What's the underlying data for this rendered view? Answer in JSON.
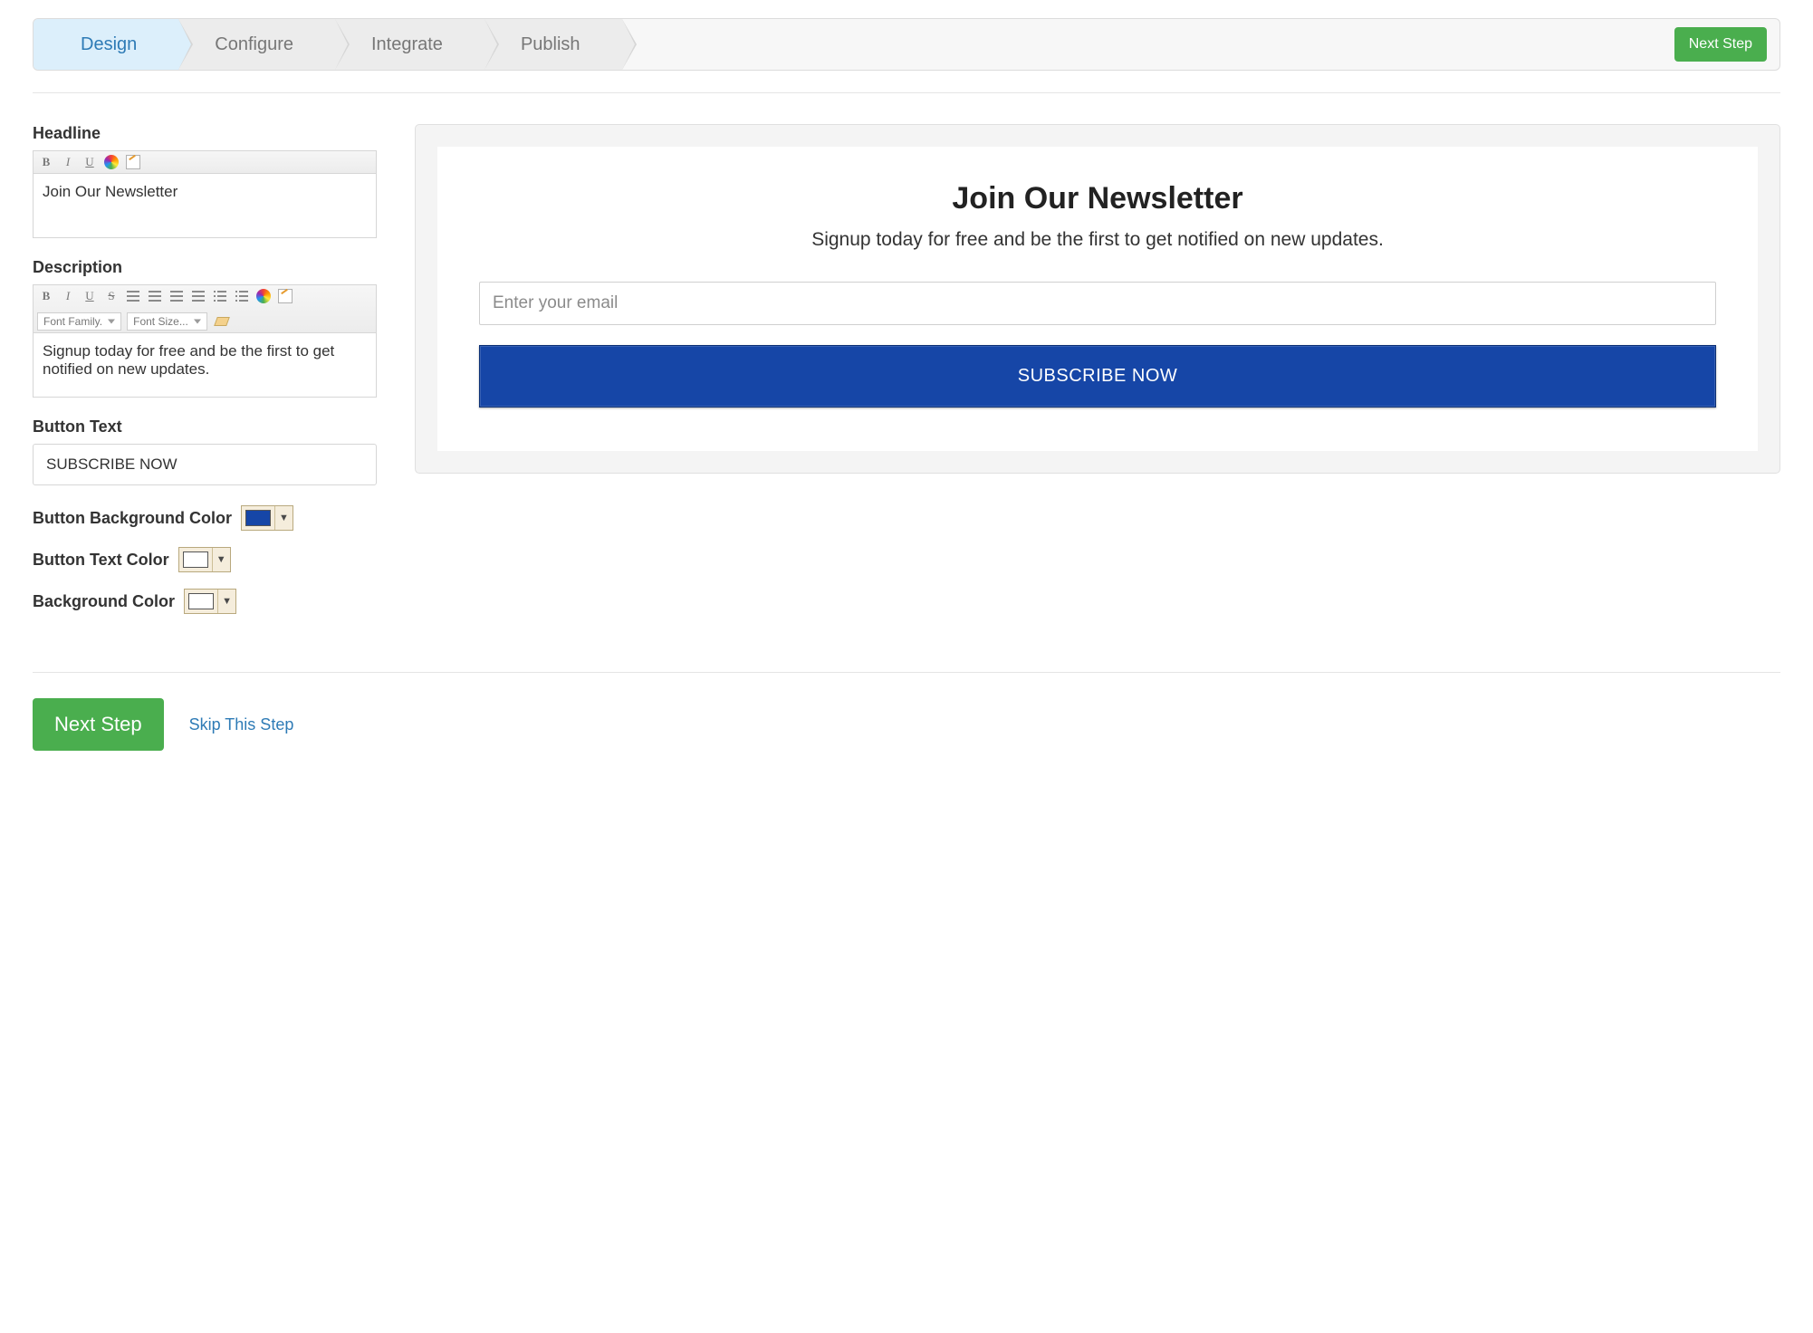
{
  "wizard": {
    "steps": [
      "Design",
      "Configure",
      "Integrate",
      "Publish"
    ],
    "active_index": 0,
    "next_button": "Next Step"
  },
  "form": {
    "headline": {
      "label": "Headline",
      "value": "Join Our Newsletter"
    },
    "description": {
      "label": "Description",
      "value": "Signup today for free and be the first to get notified on new updates.",
      "font_family_placeholder": "Font Family.",
      "font_size_placeholder": "Font Size..."
    },
    "button_text": {
      "label": "Button Text",
      "value": "SUBSCRIBE NOW"
    },
    "button_bg": {
      "label": "Button Background Color",
      "value": "#1646a7"
    },
    "button_text_color": {
      "label": "Button Text Color",
      "value": "#ffffff"
    },
    "background_color": {
      "label": "Background Color",
      "value": "#ffffff"
    }
  },
  "preview": {
    "email_placeholder": "Enter your email"
  },
  "footer": {
    "next": "Next Step",
    "skip": "Skip This Step"
  }
}
